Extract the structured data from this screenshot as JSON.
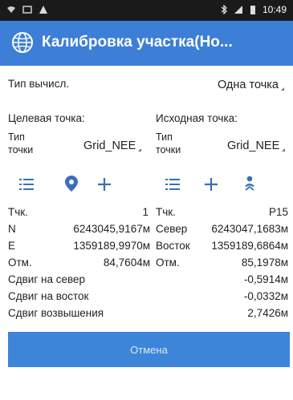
{
  "status": {
    "time": "10:49"
  },
  "appbar": {
    "title": "Калибровка участка(Но..."
  },
  "calc": {
    "label": "Тип вычисл.",
    "value": "Одна точка"
  },
  "target": {
    "header": "Целевая точка:",
    "type_label_1": "Тип",
    "type_label_2": "точки",
    "type_value": "Grid_NEE"
  },
  "source": {
    "header": "Исходная точка:",
    "type_label_1": "Тип",
    "type_label_2": "точки",
    "type_value": "Grid_NEE"
  },
  "rows": {
    "pt_l": "Тчк.",
    "pt_lv": "1",
    "pt_r": "Тчк.",
    "pt_rv": "P15",
    "n_l": "N",
    "n_lv": "6243045,9167м",
    "n_r": "Север",
    "n_rv": "6243047,1683м",
    "e_l": "E",
    "e_lv": "1359189,9970м",
    "e_r": "Восток",
    "e_rv": "1359189,6864м",
    "h_l": "Отм.",
    "h_lv": "84,7604м",
    "h_r": "Отм.",
    "h_rv": "85,1978м",
    "dn_l": "Сдвиг на север",
    "dn_v": "-0,5914м",
    "de_l": "Сдвиг на восток",
    "de_v": "-0,0332м",
    "dh_l": "Сдвиг возвышения",
    "dh_v": "2,7426м"
  },
  "cancel_label": "Отмена"
}
